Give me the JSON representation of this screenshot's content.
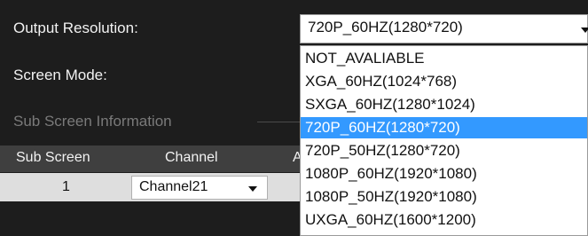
{
  "form": {
    "output_resolution_label": "Output Resolution:",
    "output_resolution_value": "720P_60HZ(1280*720)",
    "screen_mode_label": "Screen Mode:",
    "sub_screen_info_label": "Sub Screen Information"
  },
  "dropdown": {
    "options": [
      "NOT_AVALIABLE",
      "XGA_60HZ(1024*768)",
      "SXGA_60HZ(1280*1024)",
      "720P_60HZ(1280*720)",
      "720P_50HZ(1280*720)",
      "1080P_60HZ(1920*1080)",
      "1080P_50HZ(1920*1080)",
      "UXGA_60HZ(1600*1200)"
    ],
    "selected_index": 3
  },
  "table": {
    "columns": [
      "Sub Screen",
      "Channel",
      "A"
    ],
    "rows": [
      {
        "sub_screen": "1",
        "channel": "Channel21"
      }
    ]
  },
  "colors": {
    "background": "#1d1d1d",
    "selection": "#3399ff",
    "header_bg": "#3f3f3f",
    "row_bg": "#dedede"
  },
  "icons": {
    "combo_arrow": "chevron-down-icon"
  }
}
